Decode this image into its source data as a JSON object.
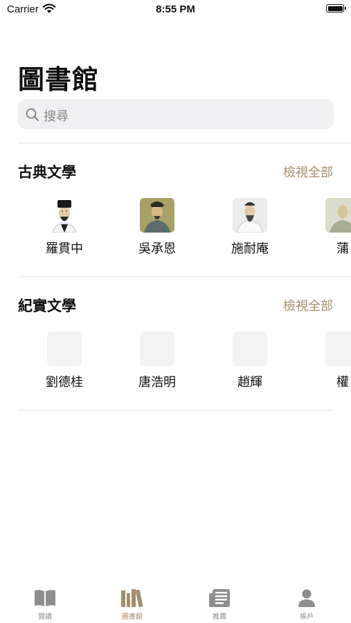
{
  "status": {
    "carrier": "Carrier",
    "time": "8:55 PM"
  },
  "page": {
    "title": "圖書館"
  },
  "search": {
    "placeholder": "搜尋"
  },
  "sections": [
    {
      "title": "古典文學",
      "view_all": "檢視全部",
      "items": [
        {
          "name": "羅貫中",
          "thumb": "portrait"
        },
        {
          "name": "吳承恩",
          "thumb": "portrait"
        },
        {
          "name": "施耐庵",
          "thumb": "portrait"
        },
        {
          "name": "蒲",
          "thumb": "portrait"
        }
      ]
    },
    {
      "title": "紀實文學",
      "view_all": "檢視全部",
      "items": [
        {
          "name": "劉德桂",
          "thumb": "placeholder"
        },
        {
          "name": "唐浩明",
          "thumb": "placeholder"
        },
        {
          "name": "趙輝",
          "thumb": "placeholder"
        },
        {
          "name": "權",
          "thumb": "placeholder"
        }
      ]
    }
  ],
  "tabs": [
    {
      "label": "閱讀",
      "icon": "book-icon"
    },
    {
      "label": "圖書館",
      "icon": "library-icon",
      "active": true
    },
    {
      "label": "推薦",
      "icon": "news-icon"
    },
    {
      "label": "帳戶",
      "icon": "person-icon"
    }
  ],
  "colors": {
    "accent": "#a58d6b",
    "inactive": "#8e8e8e",
    "search_bg": "#f0f0f2"
  }
}
